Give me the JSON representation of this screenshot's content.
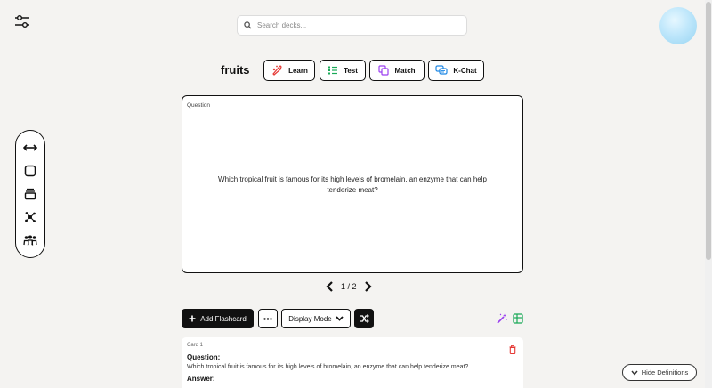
{
  "search": {
    "placeholder": "Search decks..."
  },
  "deck": {
    "title": "fruits"
  },
  "modes": [
    {
      "label": "Learn",
      "color": "#e53935"
    },
    {
      "label": "Test",
      "color": "#18a957"
    },
    {
      "label": "Match",
      "color": "#9b3ff0"
    },
    {
      "label": "K-Chat",
      "color": "#1e88e5"
    }
  ],
  "side_tools": [
    "swap-arrows-icon",
    "square-icon",
    "stack-icon",
    "network-icon",
    "group-icon"
  ],
  "flashcard": {
    "label": "Question",
    "text": "Which tropical fruit is famous for its high levels of bromelain, an enzyme that can help tenderize meat?"
  },
  "pager": {
    "text": "1 / 2"
  },
  "toolbar": {
    "add_label": "Add Flashcard",
    "display_mode_label": "Display Mode"
  },
  "card_list": [
    {
      "number": "Card 1",
      "question_heading": "Question:",
      "question_text": "Which tropical fruit is famous for its high levels of bromelain, an enzyme that can help tenderize meat?",
      "answer_heading": "Answer:"
    }
  ],
  "hide_definitions": {
    "label": "Hide Definitions"
  }
}
